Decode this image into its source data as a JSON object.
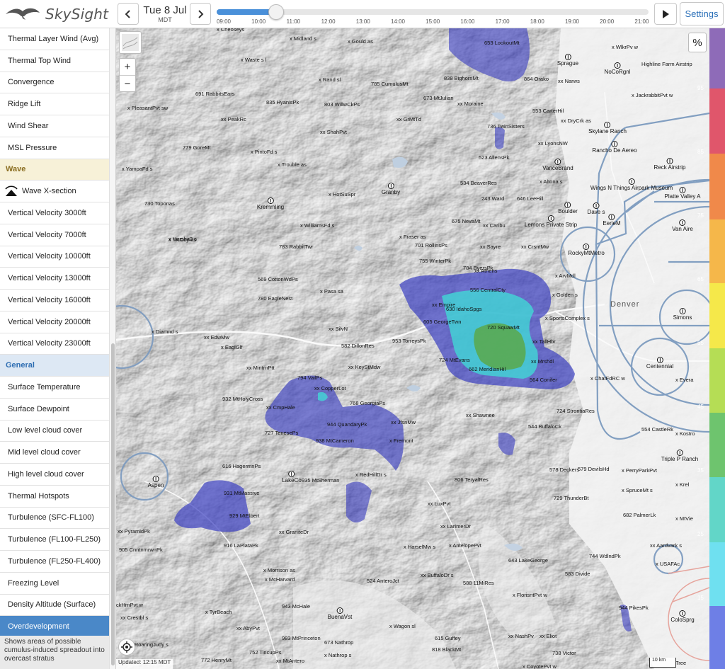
{
  "app": {
    "name": "SkySight",
    "colors": {
      "accent": "#4a88c8",
      "settings_text": "#2a6fb8",
      "overdev_low": "#3b3fc0",
      "overdev_mid": "#42d6d6",
      "overdev_high": "#5aa84a"
    }
  },
  "topbar": {
    "prev_icon": "chevron-left-icon",
    "next_icon": "chevron-right-icon",
    "date": "Tue 8 Jul",
    "timezone": "MDT",
    "time_ticks": [
      "09:00",
      "10:00",
      "11:00",
      "12:00",
      "13:00",
      "14:00",
      "15:00",
      "16:00",
      "17:00",
      "18:00",
      "19:00",
      "20:00",
      "21:00"
    ],
    "play_icon": "play-icon",
    "settings_label": "Settings"
  },
  "sidebar": {
    "items": [
      {
        "label": "Thermal Layer Wind (Avg)",
        "kind": "item"
      },
      {
        "label": "Thermal Top Wind",
        "kind": "item"
      },
      {
        "label": "Convergence",
        "kind": "item"
      },
      {
        "label": "Ridge Lift",
        "kind": "item"
      },
      {
        "label": "Wind Shear",
        "kind": "item"
      },
      {
        "label": "MSL Pressure",
        "kind": "item"
      },
      {
        "label": "Wave",
        "kind": "section-wave"
      },
      {
        "label": "Wave X-section",
        "kind": "item-icon"
      },
      {
        "label": "Vertical Velocity 3000ft",
        "kind": "item"
      },
      {
        "label": "Vertical Velocity 7000ft",
        "kind": "item"
      },
      {
        "label": "Vertical Velocity 10000ft",
        "kind": "item"
      },
      {
        "label": "Vertical Velocity 13000ft",
        "kind": "item"
      },
      {
        "label": "Vertical Velocity 16000ft",
        "kind": "item"
      },
      {
        "label": "Vertical Velocity 20000ft",
        "kind": "item"
      },
      {
        "label": "Vertical Velocity 23000ft",
        "kind": "item"
      },
      {
        "label": "General",
        "kind": "section-general"
      },
      {
        "label": "Surface Temperature",
        "kind": "item"
      },
      {
        "label": "Surface Dewpoint",
        "kind": "item"
      },
      {
        "label": "Low level cloud cover",
        "kind": "item"
      },
      {
        "label": "Mid level cloud cover",
        "kind": "item"
      },
      {
        "label": "High level cloud cover",
        "kind": "item"
      },
      {
        "label": "Thermal Hotspots",
        "kind": "item"
      },
      {
        "label": "Turbulence (SFC-FL100)",
        "kind": "item"
      },
      {
        "label": "Turbulence (FL100-FL250)",
        "kind": "item"
      },
      {
        "label": "Turbulence (FL250-FL400)",
        "kind": "item"
      },
      {
        "label": "Freezing Level",
        "kind": "item"
      },
      {
        "label": "Density Altitude (Surface)",
        "kind": "item"
      },
      {
        "label": "Overdevelopment",
        "kind": "selected"
      }
    ],
    "description": "Shows areas of possible cumulus-induced spreadout into overcast stratus"
  },
  "map": {
    "percent_button": "%",
    "zoom_in": "+",
    "zoom_out": "−",
    "locate_icon": "locate-icon",
    "layers_icon": "layers-icon",
    "updated": "Updated: 12:15 MDT",
    "scale": "10 km",
    "city": "Denver",
    "legend_colors": [
      "#8e6bb8",
      "#e0566b",
      "#f0894a",
      "#f5b74a",
      "#f5e84a",
      "#b5dd55",
      "#6ec46e",
      "#62d6c8",
      "#6fe0f0",
      "#6e7fe6",
      "#3b3fc0"
    ],
    "legend_numbers": [
      "95",
      "85",
      "75",
      "65",
      "55",
      "45",
      "35",
      "25",
      "15"
    ],
    "labels": [
      "x Cheoseys",
      "x Midland s",
      "x Gould as",
      "653 LookoutMt",
      "x WlkrPv w",
      "Sprague",
      "NoCoRgnl",
      "Highline Farm Airstrip",
      "x Waste s l",
      "x Rand sl",
      "785 CumulusMt",
      "838 BighornMt",
      "864 Orako",
      "xx Narws",
      "x JackrabbitPvt w",
      "691 RabbitsEars",
      "835 HyanisPk",
      "803 WillwCkPs",
      "673 MtJulian",
      "xx Moraine",
      "553 CarterHil",
      "x PleasantPvt sw",
      "xx PeakRc",
      "xx GrMtTd",
      "736 TwinSisters",
      "xx DryCrk as",
      "Skylane Ranch",
      "xx ShahPvt",
      "x PintoFd s",
      "779 GoreMt",
      "x Trouble as",
      "523 AllensPk",
      "xx LyonsNW",
      "Rancho De Aereo",
      "x YampaFd s",
      "Granby",
      "VanceBrand",
      "Reck Airstrip",
      "x HotSuSpr",
      "534 BeaverRes",
      "x Altona s",
      "Wings N Things Airpark Museum",
      "730 Toponas",
      "Kremmling",
      "243 Ward",
      "646 LeeHill",
      "Boulder",
      "Dave s",
      "Platte Valley A",
      "x WilliamsFd s",
      "675 NevaMt",
      "xx Caribu",
      "Lemons Private Strip",
      "EerieM",
      "Van Aire",
      "x Harsha2 s",
      "x Fraser as",
      "701 RollinsPs",
      "xx Sayre",
      "xx CrsntMw",
      "x McCoy as",
      "783 RabbitTwr",
      "RockyMtMetro",
      "755 WinterPk",
      "784 ByersPk",
      "xx Athens",
      "x ArvMdl",
      "569 CottonWdPs",
      "x Pasa sa",
      "556 CentralCty",
      "x Golden s",
      "780 EagleNest",
      "xx Empire",
      "630 IdahoSpgs",
      "x SportsComplex s",
      "Simons",
      "x Diamnd s",
      "xx SilvN",
      "605 GeorgeTwn",
      "720 SquawMt",
      "xx TallHbr",
      "xx EdwMw",
      "582 DillonRes",
      "953 TorreysPk",
      "x EaglGlf",
      "xx KeyStMdw",
      "724 MtEvans",
      "662 MeridianHil",
      "xx Mrshdl",
      "Centennial",
      "xx MintrnPtt",
      "794 VailPs",
      "564 Conifer",
      "x ChatFdRC w",
      "xx CopperLot",
      "932 MtHolyCross",
      "768 GeorgiaPs",
      "x Evera",
      "xx CmpHale",
      "xx JfsnMw",
      "xx Shawnee",
      "724 StrontiaRes",
      "944 QuandaryPk",
      "727 TenesePs",
      "938 MtCameron",
      "x Fremont",
      "544 BuffaloCk",
      "554 CastleRk",
      "x Kostro",
      "Aspen",
      "616 HagermnPs",
      "Triple P Ranch",
      "LakeCo",
      "935 MtSherman",
      "x RedHillDr s",
      "578 Deckers",
      "579 DevilsHd",
      "x PerryParkPvt",
      "806 TeryalRes",
      "931 MtMassive",
      "729 ThunderBt",
      "x SpruceMt s",
      "xx LuxPvt",
      "x Krel",
      "929 MtElbert",
      "682 PalmerLk",
      "x MtVie",
      "xx PyramidPk",
      "xx GraniteDr",
      "xx LarimerDr",
      "916 LaPlataPk",
      "x HarselMw s",
      "x AntelopePvt",
      "744 WdlndPk",
      "xx Aardvark s",
      "905 CnntnmrwnPk",
      "643 LakeGeorge",
      "x USAFAc",
      "x Morrison as",
      "583 Divide",
      "x McHarvard",
      "524 AnteroJct",
      "xx BuffaloDr s",
      "588 11MiRes",
      "x FlorisntPvt w",
      "943 McHale",
      "ckHrnPvt w",
      "944 PikesPk",
      "x TyrBeach",
      "BuenaVst",
      "xx Crestbl s",
      "xx AbyPvt",
      "x Wagon sl",
      "xx NashPv",
      "xx Eliot",
      "ColoSprg",
      "983 MtPrinceton",
      "673 Nathrop",
      "615 Guffey",
      "x RoaringJudy s",
      "752 TincupPs",
      "818 BlackMt",
      "x Nathrop s",
      "738 Victor",
      "772 HenryMt",
      "xx MtAntero",
      "x CoyotePvt w",
      "Tree"
    ]
  }
}
